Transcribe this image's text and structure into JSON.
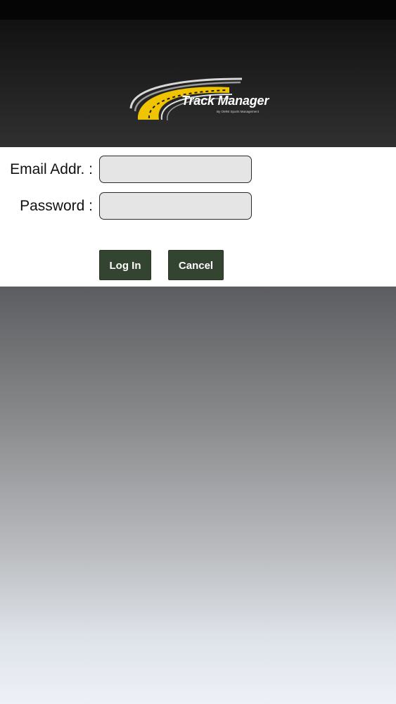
{
  "app": {
    "logo_title": "Track Manager",
    "logo_subtitle": "By OMNI Sports Management"
  },
  "login_form": {
    "email_label": "Email Addr. :",
    "email_value": "",
    "password_label": "Password :",
    "password_value": "",
    "login_button": "Log In",
    "cancel_button": "Cancel"
  },
  "colors": {
    "header_background": "#1f1f1f",
    "button_background": "#334430",
    "input_background": "#e6e5e6",
    "logo_accent_yellow": "#f0c400"
  },
  "icons": {
    "logo": "race-track-icon"
  }
}
